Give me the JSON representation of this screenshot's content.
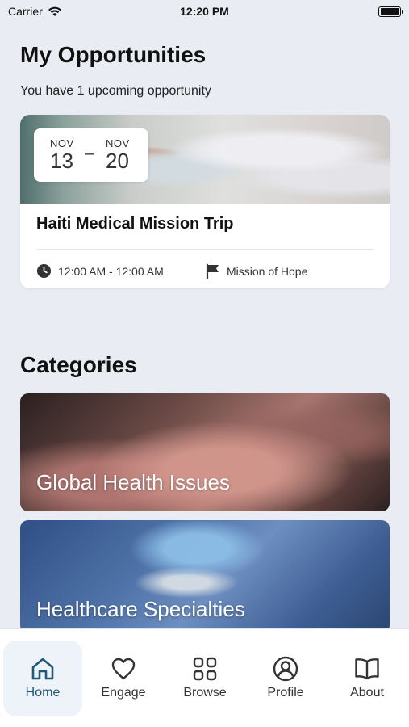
{
  "status_bar": {
    "carrier": "Carrier",
    "time": "12:20 PM"
  },
  "header": {
    "title": "My Opportunities",
    "subtitle": "You have 1 upcoming opportunity"
  },
  "opportunity": {
    "start_month": "NOV",
    "start_day": "13",
    "end_month": "NOV",
    "end_day": "20",
    "title": "Haiti Medical Mission Trip",
    "time": "12:00 AM - 12:00 AM",
    "organization": "Mission of Hope"
  },
  "categories": {
    "title": "Categories",
    "items": [
      {
        "label": "Global Health Issues"
      },
      {
        "label": "Healthcare Specialties"
      }
    ]
  },
  "tab_bar": {
    "items": [
      {
        "label": "Home",
        "icon": "home-icon",
        "active": true
      },
      {
        "label": "Engage",
        "icon": "heart-icon"
      },
      {
        "label": "Browse",
        "icon": "grid-icon"
      },
      {
        "label": "Profile",
        "icon": "user-circle-icon"
      },
      {
        "label": "About",
        "icon": "book-icon"
      }
    ]
  },
  "colors": {
    "accent": "#1f5a78",
    "background": "#e9edf3",
    "card": "#ffffff"
  }
}
